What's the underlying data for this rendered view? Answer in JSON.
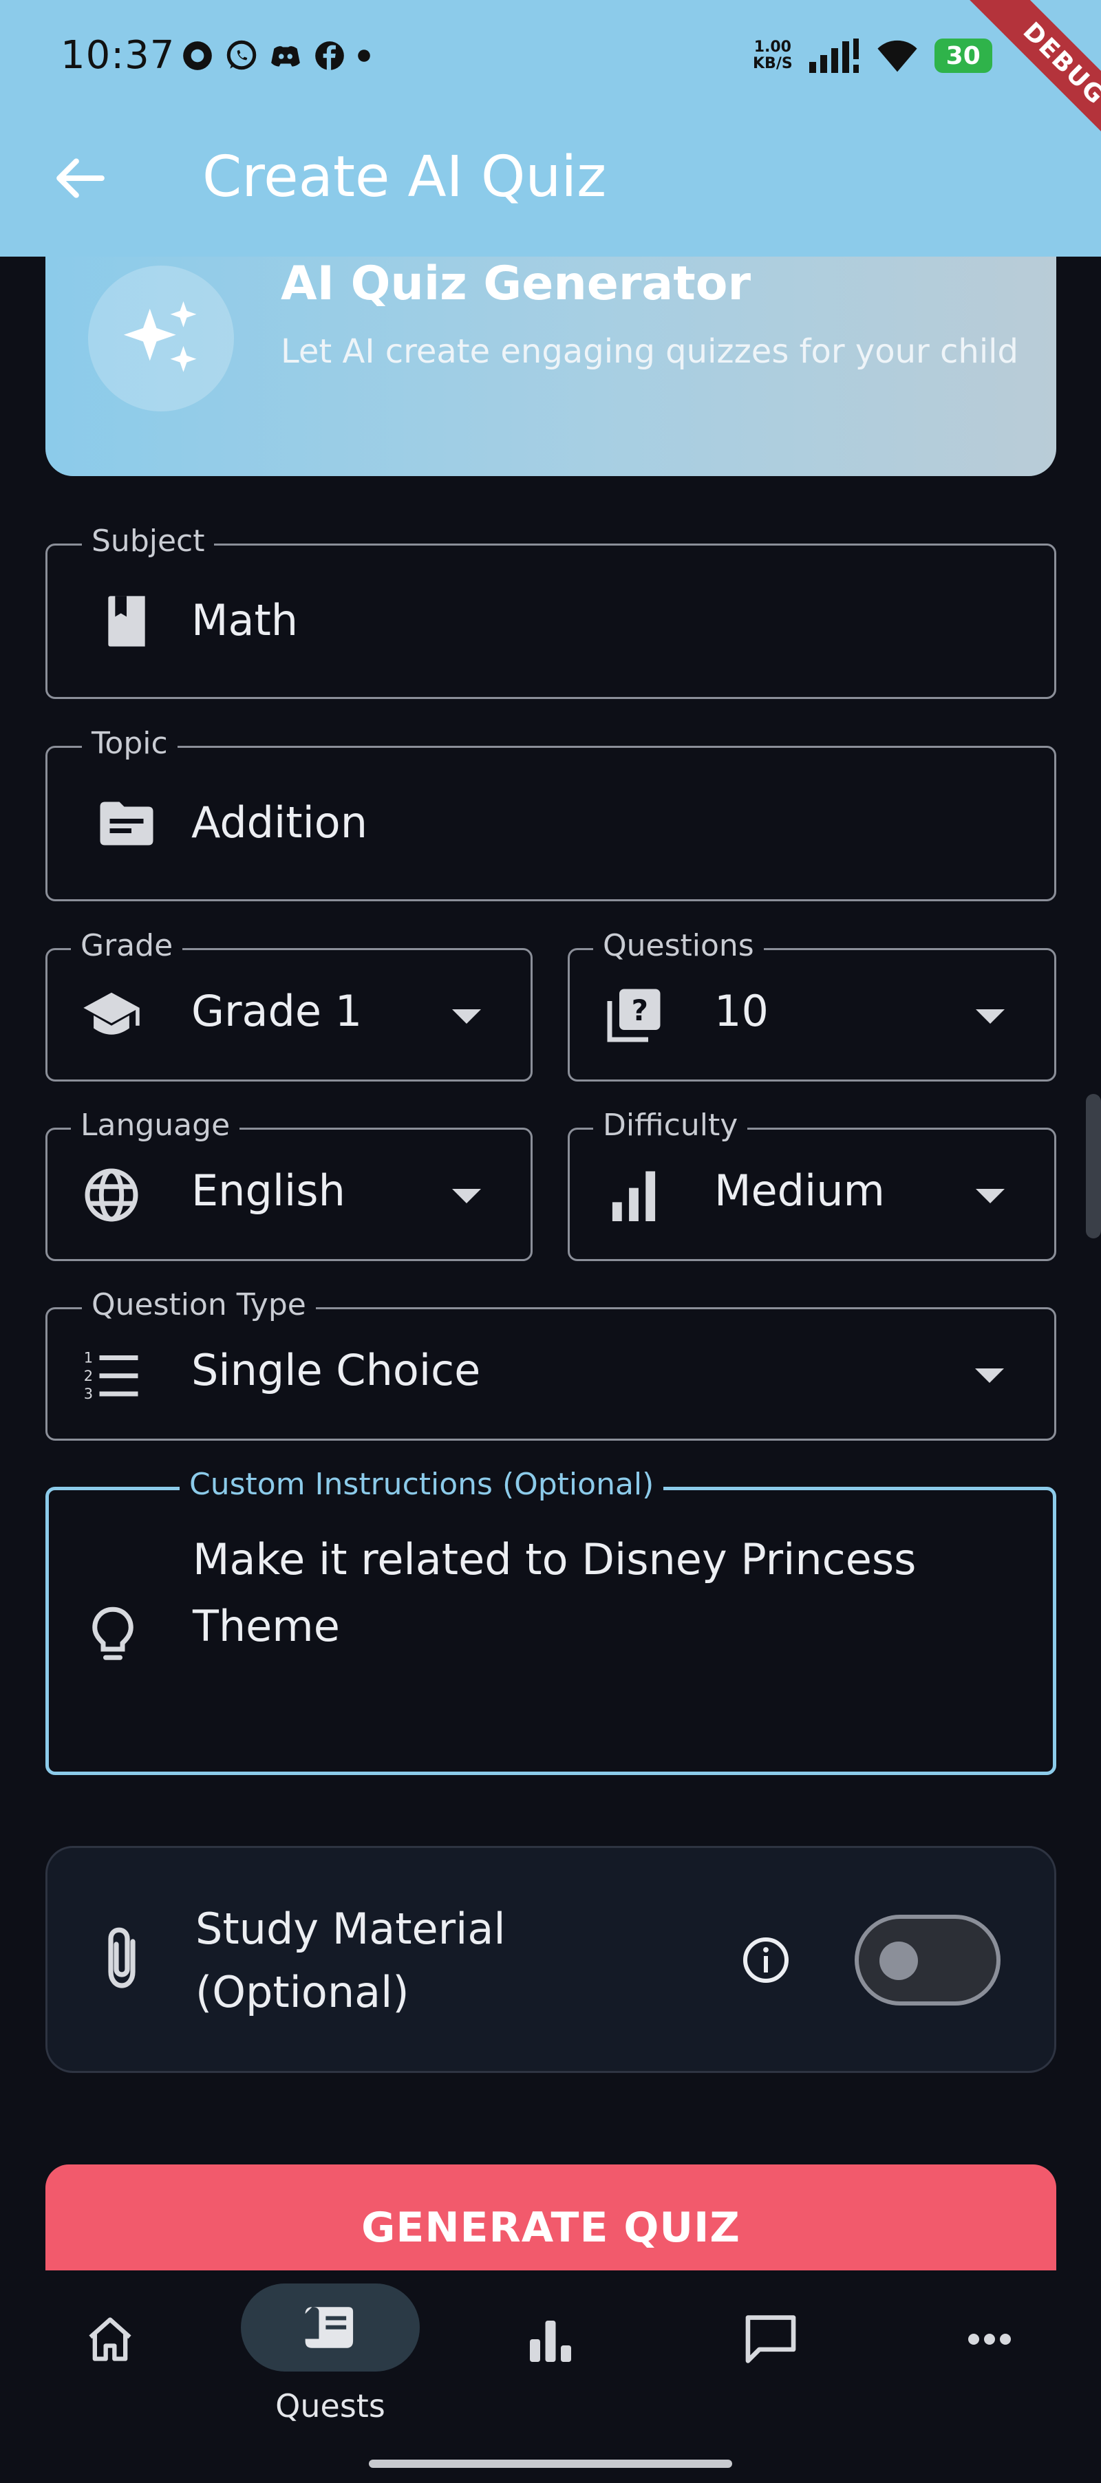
{
  "status_bar": {
    "time": "10:37",
    "net_speed_value": "1.00",
    "net_speed_unit": "KB/S",
    "battery": "30",
    "debug_banner": "DEBUG"
  },
  "app_bar": {
    "title": "Create AI Quiz"
  },
  "hero": {
    "title": "AI Quiz Generator",
    "subtitle": "Let AI create engaging quizzes for your child"
  },
  "form": {
    "subject": {
      "label": "Subject",
      "value": "Math",
      "icon": "book-icon"
    },
    "topic": {
      "label": "Topic",
      "value": "Addition",
      "icon": "topic-icon"
    },
    "grade": {
      "label": "Grade",
      "value": "Grade 1",
      "icon": "school-icon"
    },
    "questions": {
      "label": "Questions",
      "value": "10",
      "icon": "quiz-icon"
    },
    "language": {
      "label": "Language",
      "value": "English",
      "icon": "globe-icon"
    },
    "difficulty": {
      "label": "Difficulty",
      "value": "Medium",
      "icon": "bar-chart-icon"
    },
    "question_type": {
      "label": "Question Type",
      "value": "Single Choice",
      "icon": "numbered-list-icon"
    },
    "custom_instructions": {
      "label": "Custom Instructions (Optional)",
      "line1": "Make it related to Disney Princess",
      "line2": "Theme",
      "icon": "lightbulb-icon"
    }
  },
  "study_material": {
    "line1": "Study Material",
    "line2": "(Optional)",
    "enabled": false
  },
  "generate_button": {
    "label": "GENERATE QUIZ"
  },
  "bottom_nav": {
    "items": [
      {
        "name": "home",
        "label": ""
      },
      {
        "name": "quests",
        "label": "Quests",
        "active": true
      },
      {
        "name": "stats",
        "label": ""
      },
      {
        "name": "chat",
        "label": ""
      },
      {
        "name": "more",
        "label": ""
      }
    ]
  },
  "colors": {
    "accent": "#8ccbea",
    "background": "#0d0f17",
    "primary_button": "#f25a6c",
    "battery": "#2fb34a"
  }
}
